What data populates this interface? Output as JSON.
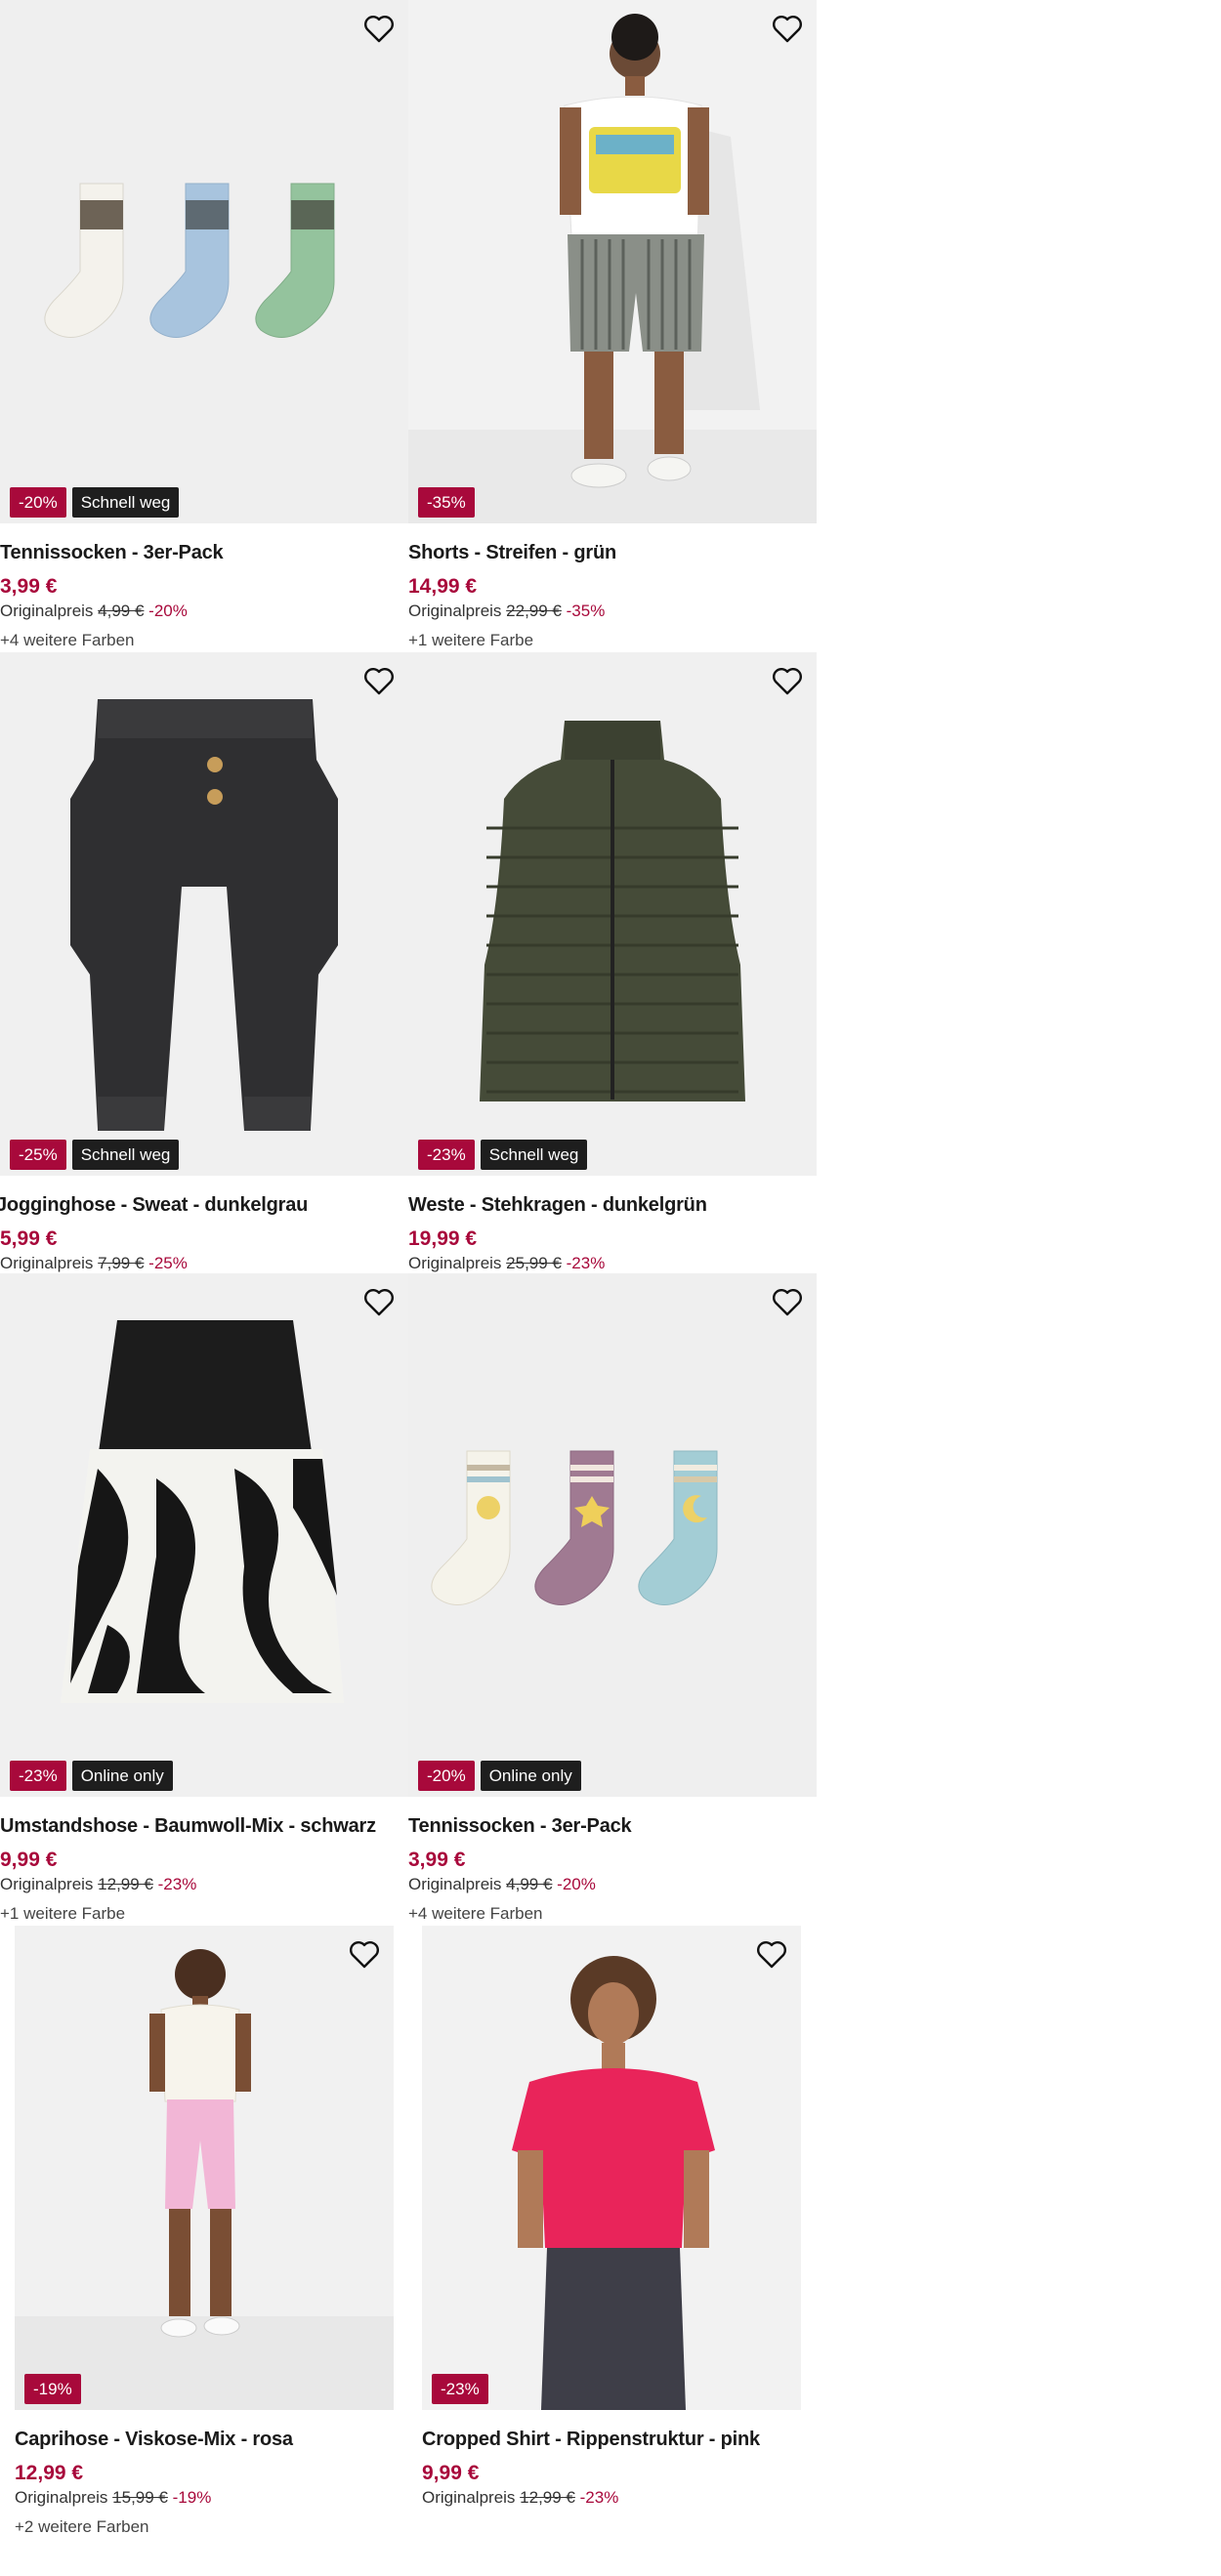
{
  "products": [
    {
      "title": "Tennissocken - 3er-Pack",
      "price": "3,99 €",
      "orig_label": "Originalpreis",
      "orig_price": "4,99 €",
      "discount": "-20%",
      "badge_sale": "-20%",
      "badge_tag": "Schnell weg",
      "colors": "+4 weitere Farben"
    },
    {
      "title": "Shorts - Streifen - grün",
      "price": "14,99 €",
      "orig_label": "Originalpreis",
      "orig_price": "22,99 €",
      "discount": "-35%",
      "badge_sale": "-35%",
      "badge_tag": "",
      "colors": "+1 weitere Farbe"
    },
    {
      "title": "Jogginghose - Sweat - dunkelgrau",
      "price": "5,99 €",
      "orig_label": "Originalpreis",
      "orig_price": "7,99 €",
      "discount": "-25%",
      "badge_sale": "-25%",
      "badge_tag": "Schnell weg",
      "colors": ""
    },
    {
      "title": "Weste - Stehkragen - dunkelgrün",
      "price": "19,99 €",
      "orig_label": "Originalpreis",
      "orig_price": "25,99 €",
      "discount": "-23%",
      "badge_sale": "-23%",
      "badge_tag": "Schnell weg",
      "colors": ""
    },
    {
      "title": "Umstandshose - Baumwoll-Mix - schwarz",
      "price": "9,99 €",
      "orig_label": "Originalpreis",
      "orig_price": "12,99 €",
      "discount": "-23%",
      "badge_sale": "-23%",
      "badge_tag": "Online only",
      "colors": "+1 weitere Farbe"
    },
    {
      "title": "Tennissocken - 3er-Pack",
      "price": "3,99 €",
      "orig_label": "Originalpreis",
      "orig_price": "4,99 €",
      "discount": "-20%",
      "badge_sale": "-20%",
      "badge_tag": "Online only",
      "colors": "+4 weitere Farben"
    },
    {
      "title": "Caprihose - Viskose-Mix - rosa",
      "price": "12,99 €",
      "orig_label": "Originalpreis",
      "orig_price": "15,99 €",
      "discount": "-19%",
      "badge_sale": "-19%",
      "badge_tag": "",
      "colors": "+2 weitere Farben"
    },
    {
      "title": "Cropped Shirt - Rippenstruktur - pink",
      "price": "9,99 €",
      "orig_label": "Originalpreis",
      "orig_price": "12,99 €",
      "discount": "-23%",
      "badge_sale": "-23%",
      "badge_tag": "",
      "colors": ""
    }
  ],
  "icons": {
    "favorite": "heart-icon"
  },
  "colors": {
    "sale": "#a8093b",
    "tag_bg": "#1e1e1e"
  }
}
